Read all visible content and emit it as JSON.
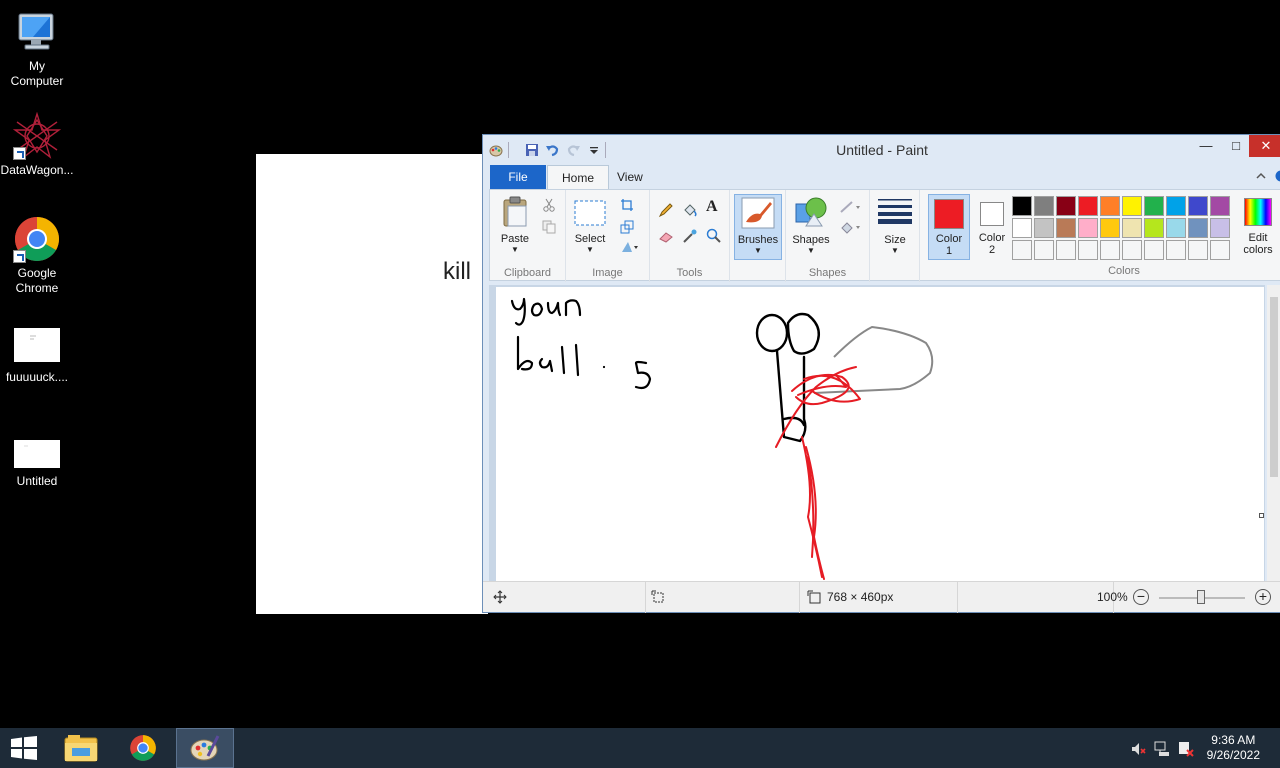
{
  "desktop": {
    "icons": [
      {
        "label": "My\nComputer",
        "icon": "my-computer-icon"
      },
      {
        "label": "DataWagon...",
        "icon": "datawagon-icon"
      },
      {
        "label": "Google\nChrome",
        "icon": "chrome-icon"
      },
      {
        "label": "fuuuuuck....",
        "icon": "document-icon"
      },
      {
        "label": "Untitled",
        "icon": "image-file-icon"
      }
    ],
    "background_doc_text": "kill"
  },
  "paint": {
    "title": "Untitled - Paint",
    "tabs": {
      "file": "File",
      "home": "Home",
      "view": "View"
    },
    "ribbon": {
      "clipboard": {
        "paste": "Paste",
        "group": "Clipboard"
      },
      "image": {
        "select": "Select",
        "group": "Image"
      },
      "tools": {
        "group": "Tools"
      },
      "brushes": {
        "label": "Brushes"
      },
      "shapes": {
        "label": "Shapes",
        "group": "Shapes"
      },
      "size": {
        "label": "Size"
      },
      "color1": {
        "label": "Color",
        "num": "1"
      },
      "color2": {
        "label": "Color",
        "num": "2"
      },
      "colors_group": "Colors",
      "edit_colors": {
        "line1": "Edit",
        "line2": "colors"
      }
    },
    "palette_row1": [
      "#000000",
      "#7f7f7f",
      "#880015",
      "#ed1c24",
      "#ff7f27",
      "#fff200",
      "#22b14c",
      "#00a2e8",
      "#3f48cc",
      "#a349a4"
    ],
    "palette_row2": [
      "#ffffff",
      "#c3c3c3",
      "#b97a57",
      "#ffaec9",
      "#ffc90e",
      "#efe4b0",
      "#b5e61d",
      "#99d9ea",
      "#7092be",
      "#c8bfe7"
    ],
    "color1_value": "#ed1c24",
    "color2_value": "#ffffff",
    "canvas_drawing_text": [
      "your",
      "ball 5"
    ],
    "status": {
      "dimensions": "768 × 460px",
      "zoom": "100%"
    }
  },
  "taskbar": {
    "time": "9:36 AM",
    "date": "9/26/2022"
  }
}
